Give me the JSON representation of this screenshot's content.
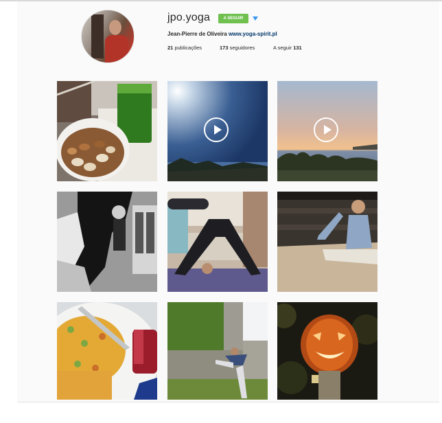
{
  "profile": {
    "username": "jpo.yoga",
    "follow_label": "A SEGUIR",
    "full_name": "Jean-Pierre de Oliveira",
    "website": "www.yoga-spirit.pl",
    "stats": {
      "posts_count": "21",
      "posts_label": "publicações",
      "followers_count": "173",
      "followers_label": "seguidores",
      "following_label": "A seguir",
      "following_count": "131"
    }
  },
  "posts": [
    {
      "subject": "nuts-and-green-juice",
      "video": false
    },
    {
      "subject": "sun-over-sea-video",
      "video": true
    },
    {
      "subject": "sunset-over-sea-video",
      "video": true
    },
    {
      "subject": "people-stretching-bw",
      "video": false
    },
    {
      "subject": "downward-dog-pose",
      "video": false
    },
    {
      "subject": "seated-meditation",
      "video": false
    },
    {
      "subject": "chickpea-salad-and-wine",
      "video": false
    },
    {
      "subject": "yoga-pose-by-castle-wall",
      "video": false
    },
    {
      "subject": "carved-pumpkin-lantern",
      "video": false
    }
  ],
  "colors": {
    "follow_button": "#70c050",
    "dropdown_arrow": "#3897f0",
    "link": "#003569"
  }
}
